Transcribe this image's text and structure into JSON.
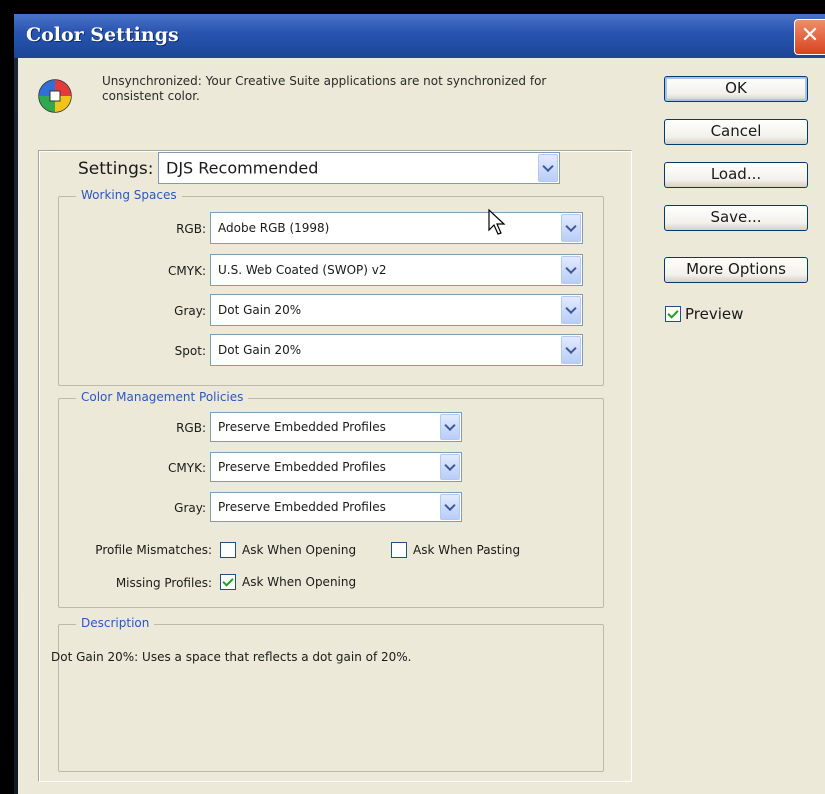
{
  "window": {
    "title": "Color Settings",
    "close_glyph": "✕"
  },
  "sync_message": "Unsynchronized: Your Creative Suite applications are not synchronized for consistent color.",
  "settings": {
    "label": "Settings:",
    "value": "DJS Recommended"
  },
  "working_spaces": {
    "legend": "Working Spaces",
    "rows": [
      {
        "label": "RGB:",
        "value": "Adobe RGB (1998)"
      },
      {
        "label": "CMYK:",
        "value": "U.S. Web Coated (SWOP) v2"
      },
      {
        "label": "Gray:",
        "value": "Dot Gain 20%"
      },
      {
        "label": "Spot:",
        "value": "Dot Gain 20%"
      }
    ]
  },
  "policies": {
    "legend": "Color Management Policies",
    "rows": [
      {
        "label": "RGB:",
        "value": "Preserve Embedded Profiles"
      },
      {
        "label": "CMYK:",
        "value": "Preserve Embedded Profiles"
      },
      {
        "label": "Gray:",
        "value": "Preserve Embedded Profiles"
      }
    ],
    "profile_mismatches": {
      "label": "Profile Mismatches:",
      "ask_opening": {
        "label": "Ask When Opening",
        "checked": false
      },
      "ask_pasting": {
        "label": "Ask When Pasting",
        "checked": false
      }
    },
    "missing_profiles": {
      "label": "Missing Profiles:",
      "ask_opening": {
        "label": "Ask When Opening",
        "checked": true
      }
    }
  },
  "description": {
    "legend": "Description",
    "text": "Dot Gain 20%: Uses a space that reflects a dot gain of 20%."
  },
  "buttons": {
    "ok": "OK",
    "cancel": "Cancel",
    "load": "Load...",
    "save": "Save...",
    "more_options": "More Options"
  },
  "preview": {
    "label": "Preview",
    "checked": true
  },
  "icons": {
    "app": "color-settings-icon",
    "cursor": "mouse-pointer-icon"
  },
  "colors": {
    "title_bar": "#2350a8",
    "dialog_bg": "#ece9d8",
    "legend_text": "#2a57c6",
    "close": "#d8441f"
  }
}
